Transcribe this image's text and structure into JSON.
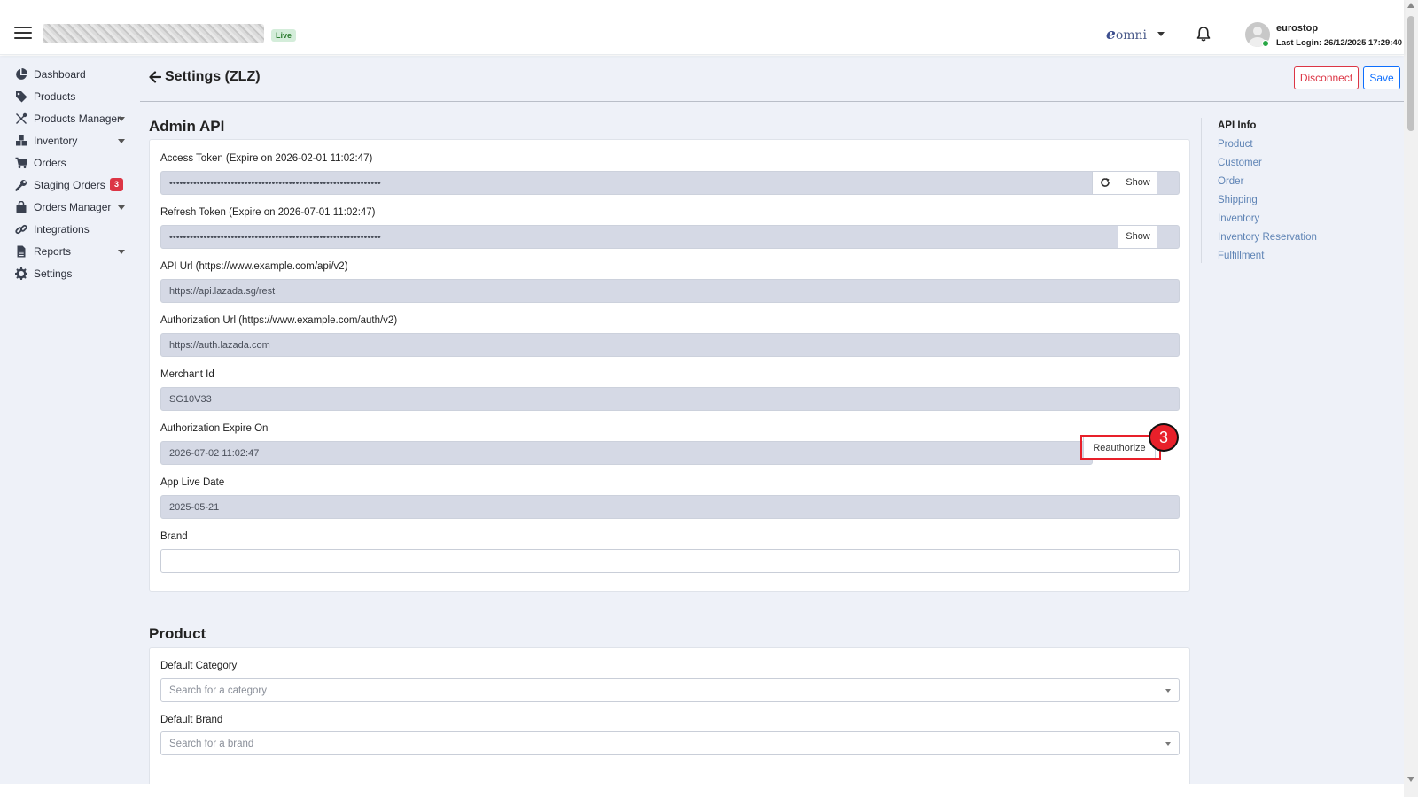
{
  "header": {
    "env_badge": "Live",
    "brand_e": "e",
    "brand_text": "omni",
    "user_name": "eurostop",
    "last_login": "Last Login: 26/12/2025 17:29:40"
  },
  "sidebar": {
    "items": [
      {
        "label": "Dashboard",
        "icon": "pie-chart-icon"
      },
      {
        "label": "Products",
        "icon": "tag-icon"
      },
      {
        "label": "Products Manager",
        "icon": "tools-icon"
      },
      {
        "label": "Inventory",
        "icon": "boxes-icon"
      },
      {
        "label": "Orders",
        "icon": "cart-icon"
      },
      {
        "label": "Staging Orders",
        "icon": "wrench-icon",
        "badge": "3"
      },
      {
        "label": "Orders Manager",
        "icon": "bag-icon"
      },
      {
        "label": "Integrations",
        "icon": "link-icon"
      },
      {
        "label": "Reports",
        "icon": "file-icon"
      },
      {
        "label": "Settings",
        "icon": "gear-icon"
      }
    ]
  },
  "page": {
    "title": "Settings (ZLZ)",
    "disconnect_label": "Disconnect",
    "save_label": "Save"
  },
  "admin_api": {
    "title": "Admin API",
    "access_token": {
      "label": "Access Token (Expire on 2026-02-01 11:02:47)",
      "value": "••••••••••••••••••••••••••••••••••••••••••••••••••••••••••••••",
      "show_label": "Show"
    },
    "refresh_token": {
      "label": "Refresh Token (Expire on 2026-07-01 11:02:47)",
      "value": "••••••••••••••••••••••••••••••••••••••••••••••••••••••••••••••",
      "show_label": "Show"
    },
    "api_url": {
      "label": "API Url (https://www.example.com/api/v2)",
      "value": "https://api.lazada.sg/rest"
    },
    "auth_url": {
      "label": "Authorization Url (https://www.example.com/auth/v2)",
      "value": "https://auth.lazada.com"
    },
    "merchant_id": {
      "label": "Merchant Id",
      "value": "SG10V33"
    },
    "auth_expire": {
      "label": "Authorization Expire On",
      "value": "2026-07-02 11:02:47",
      "button": "Reauthorize"
    },
    "app_live_date": {
      "label": "App Live Date",
      "value": "2025-05-21"
    },
    "brand": {
      "label": "Brand",
      "value": ""
    }
  },
  "product": {
    "title": "Product",
    "default_category": {
      "label": "Default Category",
      "placeholder": "Search for a category"
    },
    "default_brand": {
      "label": "Default Brand",
      "placeholder": "Search for a brand"
    }
  },
  "api_info": {
    "title": "API Info",
    "links": [
      "Product",
      "Customer",
      "Order",
      "Shipping",
      "Inventory",
      "Inventory Reservation",
      "Fulfillment"
    ]
  },
  "annotation": {
    "step": "3"
  },
  "colors": {
    "accent": "#0d6efd",
    "danger": "#dc3545",
    "marker": "#e8202a",
    "link": "#5f84b5"
  }
}
